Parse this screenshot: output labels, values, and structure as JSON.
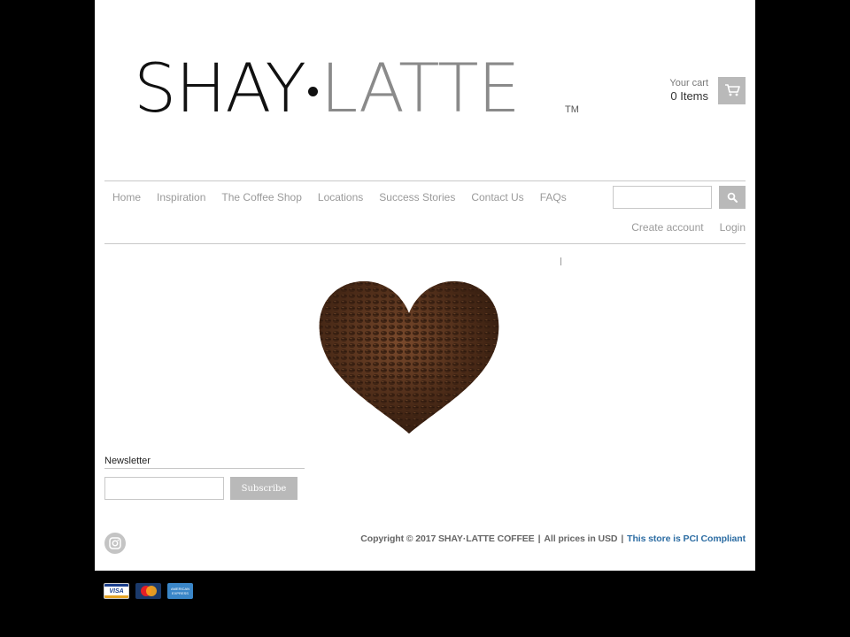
{
  "brand": {
    "logo_dark": "SHAY",
    "logo_light": "LATTE",
    "trademark": "TM"
  },
  "cart": {
    "label": "Your cart",
    "count": "0 Items",
    "icon": "cart-icon"
  },
  "nav": {
    "items": [
      "Home",
      "Inspiration",
      "The Coffee Shop",
      "Locations",
      "Success Stories",
      "Contact Us",
      "FAQs"
    ]
  },
  "search": {
    "placeholder": "",
    "icon": "search-icon"
  },
  "account": {
    "create": "Create account",
    "login": "Login"
  },
  "hero": {
    "image": "coffee-bean-heart"
  },
  "newsletter": {
    "title": "Newsletter",
    "placeholder": "",
    "button": "Subscribe"
  },
  "footer": {
    "copyright": "Copyright © 2017 SHAY·LATTE COFFEE",
    "prices": "All prices in USD",
    "pci": "This store is PCI Compliant",
    "separator": "|"
  },
  "payments": {
    "visa": "VISA",
    "amex": "AMERICAN EXPRESS"
  },
  "colors": {
    "button_gray": "#b9b9b9",
    "link_blue": "#2d6da3",
    "nav_gray": "#9a9a9a"
  }
}
